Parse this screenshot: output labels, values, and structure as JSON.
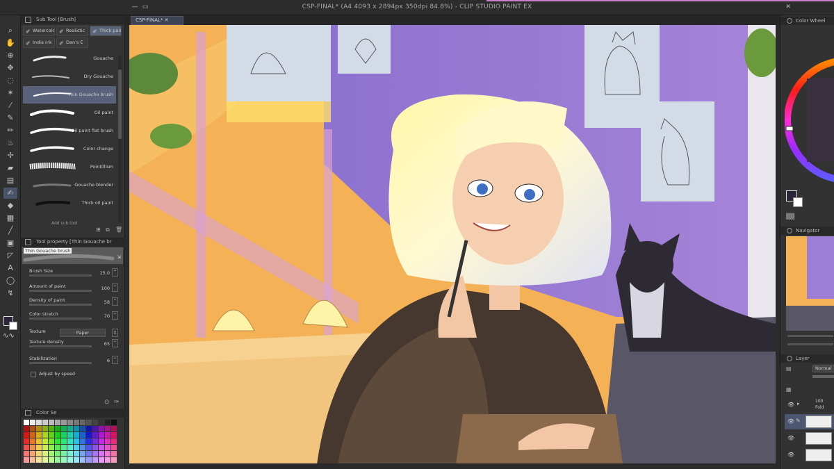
{
  "app": {
    "title": "CSP-FINAL* (A4 4093 x 2894px 350dpi 84.8%) - CLIP STUDIO PAINT EX"
  },
  "canvas_tab": {
    "label": "CSP-FINAL*"
  },
  "colors": {
    "accent": "#59627a",
    "panel": "#333333",
    "canvas_orange": "#f6b458",
    "wall_purple": "#9d7ed6",
    "fg_swatch": "#2c2438"
  },
  "toolbar": {
    "tools": [
      "magnifier-icon",
      "hand-icon",
      "rotate-icon",
      "move-icon",
      "lasso-icon",
      "auto-select-icon",
      "eyedropper-icon",
      "pen-icon",
      "pencil-icon",
      "brush-icon",
      "airbrush-icon",
      "decoration-icon",
      "eraser-icon",
      "blend-icon",
      "fill-icon",
      "gradient-icon",
      "figure-icon",
      "frame-icon",
      "ruler-icon",
      "text-icon",
      "balloon-icon",
      "correct-line-icon"
    ]
  },
  "subtool_panel": {
    "title": "Sub Tool [Brush]",
    "tabs": [
      "Watercolor",
      "Realistic",
      "Thick paint",
      "India ink",
      "Dan's E"
    ],
    "brushes": [
      "Gouache",
      "Dry Gouache",
      "Thin Gouache brush",
      "Oil paint",
      "Oil paint flat brush",
      "Color change",
      "Pointillism",
      "Gouache blender",
      "Thick oil paint"
    ],
    "add_label": "Add sub tool"
  },
  "tool_property": {
    "title": "Tool property [Thin Gouache br",
    "brush_label": "Thin Gouache brush",
    "rows": [
      {
        "label": "Brush Size",
        "value": "15.0"
      },
      {
        "label": "Amount of paint",
        "value": "100"
      },
      {
        "label": "Density of paint",
        "value": "58"
      },
      {
        "label": "Color stretch",
        "value": "70"
      },
      {
        "label": "Texture density",
        "value": "65"
      },
      {
        "label": "Stabilization",
        "value": "6"
      }
    ],
    "texture_label": "Texture",
    "texture_value": "Paper",
    "adjust_label": "Adjust by speed"
  },
  "color_set": {
    "title": "Color Se"
  },
  "right": {
    "color_wheel": {
      "title": "Color Wheel"
    },
    "navigator": {
      "title": "Navigator"
    },
    "layer": {
      "title": "Layer",
      "blend": "Normal",
      "folder_label": "100",
      "folder_sub": "Fold"
    }
  }
}
